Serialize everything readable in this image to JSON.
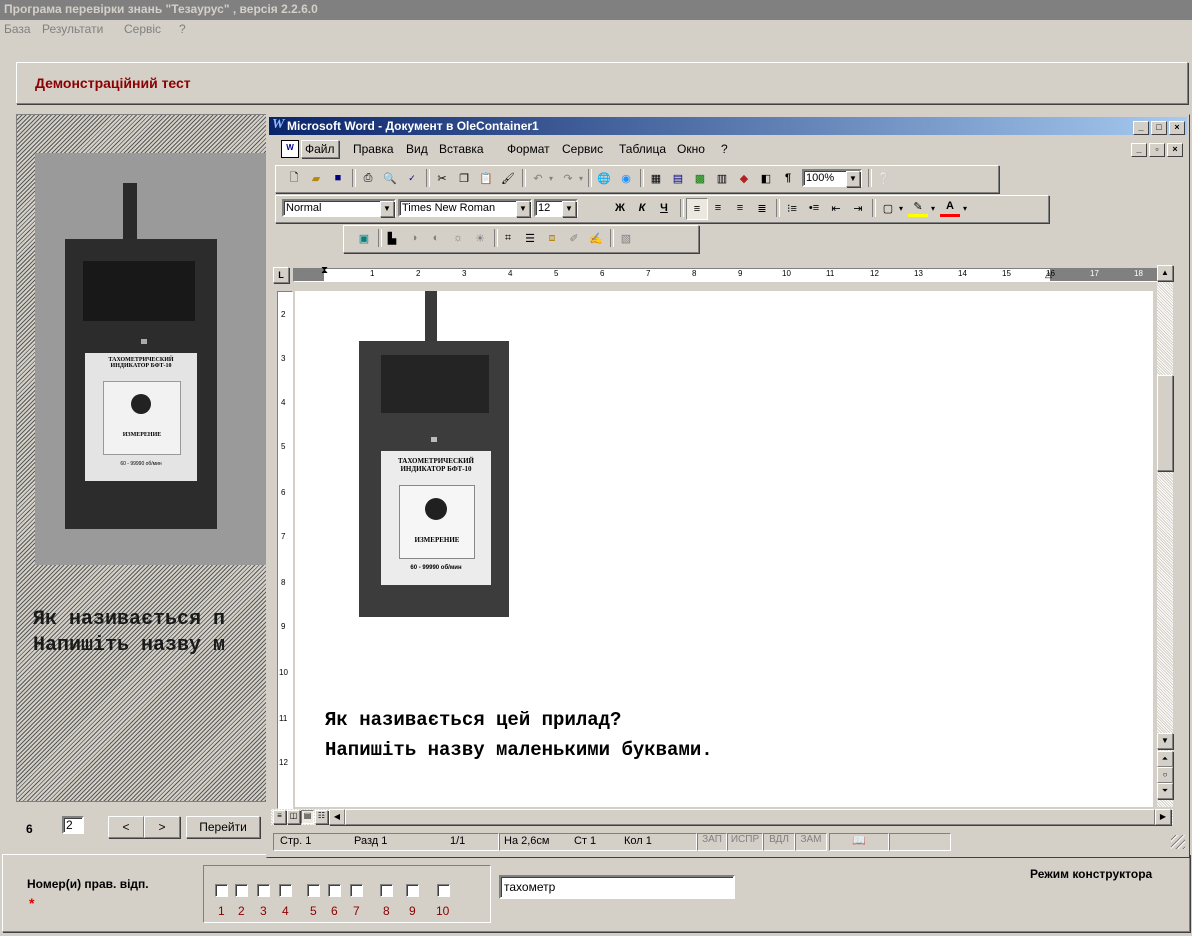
{
  "app": {
    "title": "Програма перевірки знань \"Тезаурус\" , версія 2.2.6.0",
    "menu": [
      "База",
      "Результати",
      "Сервіс",
      "?"
    ]
  },
  "test": {
    "title": "Демонстраційний тест",
    "question_line1": "Як називається цей прилад?",
    "question_line2": "Напишіть назву маленькими буквами.",
    "left_line1": "Як називається п",
    "left_line2": "Напишіть назву м"
  },
  "device_label": {
    "line1": "ТАХОМЕТРИЧЕСКИЙ",
    "line2": "ИНДИКАТОР БФТ-10",
    "button": "ИЗМЕРЕНИЕ",
    "range": "60 - 99990 об/мин"
  },
  "nav": {
    "count": "6",
    "page_value": "2",
    "prev": "<",
    "next": ">",
    "go": "Перейти"
  },
  "answer": {
    "label": "Номер(и) прав. відп.",
    "required_mark": "*",
    "numbers": [
      "1",
      "2",
      "3",
      "4",
      "5",
      "6",
      "7",
      "8",
      "9",
      "10"
    ],
    "text_value": "тахометр",
    "mode": "Режим конструктора"
  },
  "word": {
    "title": "Microsoft Word - Документ в OleContainer1",
    "menu": [
      "Файл",
      "Правка",
      "Вид",
      "Вставка",
      "Формат",
      "Сервис",
      "Таблица",
      "Окно",
      "?"
    ],
    "style": "Normal",
    "font": "Times New Roman",
    "size": "12",
    "zoom": "100%",
    "bold": "Ж",
    "italic": "К",
    "underline": "Ч",
    "ruler_numbers": [
      "1",
      "2",
      "3",
      "4",
      "5",
      "6",
      "7",
      "8",
      "9",
      "10",
      "11",
      "12",
      "13",
      "14",
      "15",
      "16",
      "17",
      "18"
    ],
    "vruler_numbers": [
      "2",
      "3",
      "4",
      "5",
      "6",
      "7",
      "8",
      "9",
      "10",
      "11",
      "12"
    ],
    "status": {
      "page": "Стр. 1",
      "section": "Разд 1",
      "pages": "1/1",
      "at": "На 2,6см",
      "line": "Ст 1",
      "col": "Кол 1",
      "rec": "ЗАП",
      "trk": "ИСПР",
      "ext": "ВДЛ",
      "ovr": "ЗАМ"
    }
  },
  "colors": {
    "titlebar_inactive": "#808080",
    "word_title_start": "#0a246a",
    "word_title_end": "#a6caf0",
    "accent_red": "#8b0000"
  }
}
